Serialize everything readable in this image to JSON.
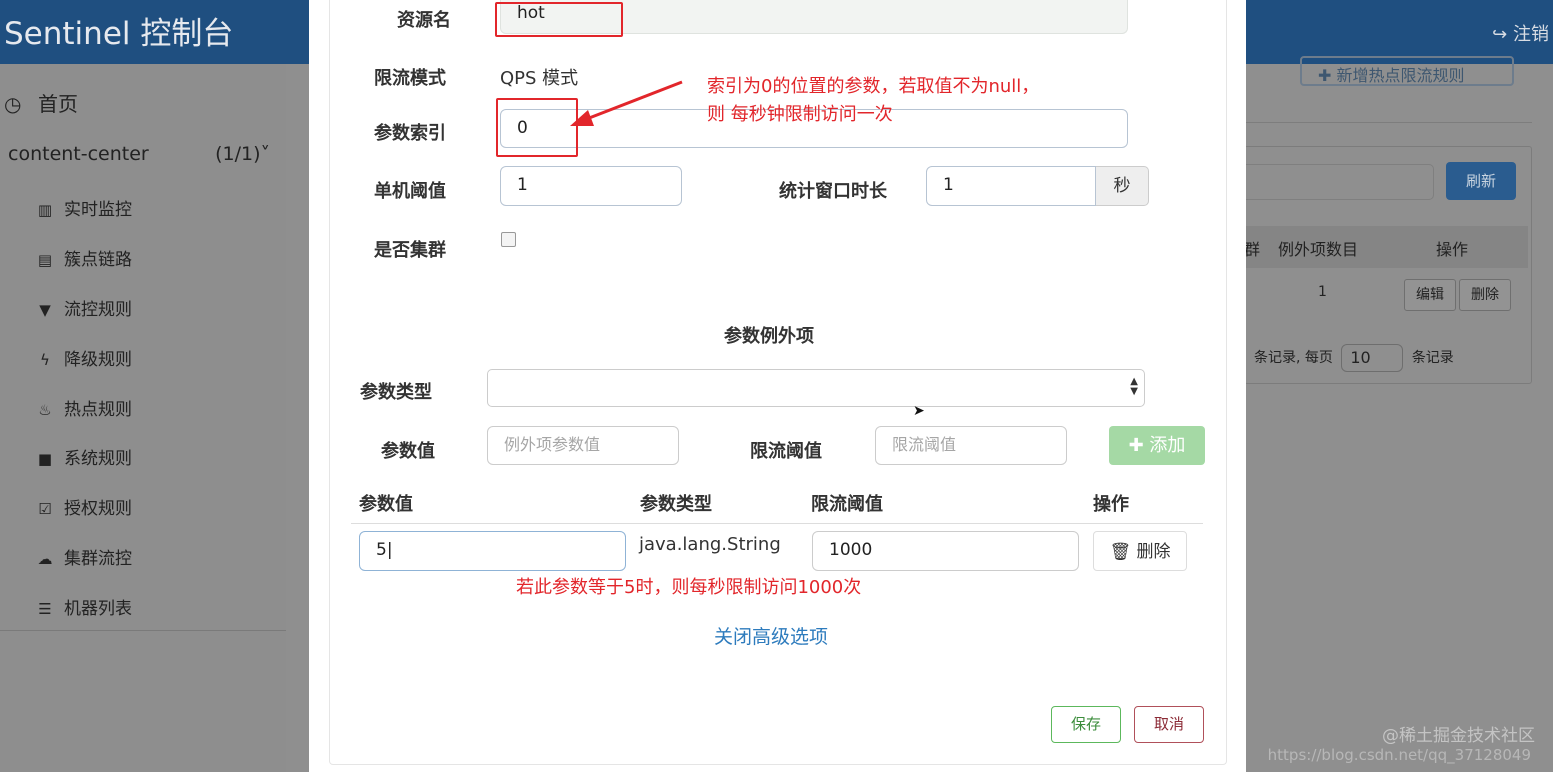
{
  "app": {
    "title": "Sentinel 控制台",
    "logout": "注销"
  },
  "sidebar": {
    "home": "首页",
    "app_name": "content-center",
    "app_count": "(1/1)",
    "items": [
      {
        "label": "实时监控",
        "icon": "bar-chart-icon"
      },
      {
        "label": "簇点链路",
        "icon": "list-icon"
      },
      {
        "label": "流控规则",
        "icon": "filter-icon"
      },
      {
        "label": "降级规则",
        "icon": "bolt-icon"
      },
      {
        "label": "热点规则",
        "icon": "fire-icon"
      },
      {
        "label": "系统规则",
        "icon": "lock-icon"
      },
      {
        "label": "授权规则",
        "icon": "check-square-icon"
      },
      {
        "label": "集群流控",
        "icon": "cloud-icon"
      },
      {
        "label": "机器列表",
        "icon": "list-ul-icon"
      }
    ]
  },
  "background": {
    "add_rule_button": "新增热点限流规则",
    "refresh_button": "刷新",
    "table_headers": [
      "群",
      "例外项数目",
      "操作"
    ],
    "row_exception_count": "1",
    "edit_button": "编辑",
    "delete_button": "删除",
    "pager_prefix": "条记录, 每页",
    "page_size": "10",
    "pager_suffix": "条记录"
  },
  "form": {
    "resource_label": "资源名",
    "resource_value": "hot",
    "mode_label": "限流模式",
    "mode_value": "QPS 模式",
    "param_index_label": "参数索引",
    "param_index_value": "0",
    "threshold_label": "单机阈值",
    "threshold_value": "1",
    "window_label": "统计窗口时长",
    "window_value": "1",
    "window_unit": "秒",
    "cluster_label": "是否集群",
    "cluster_checked": false
  },
  "exceptions": {
    "section_title": "参数例外项",
    "param_type_label": "参数类型",
    "param_type_value": "",
    "param_value_label": "参数值",
    "param_value_placeholder": "例外项参数值",
    "limit_label": "限流阈值",
    "limit_placeholder": "限流阈值",
    "add_button": "添加",
    "table_headers": [
      "参数值",
      "参数类型",
      "限流阈值",
      "操作"
    ],
    "rows": [
      {
        "value": "5",
        "type": "java.lang.String",
        "limit": "1000",
        "action": "删除"
      }
    ],
    "close_advanced": "关闭高级选项"
  },
  "footer": {
    "save": "保存",
    "cancel": "取消"
  },
  "annotations": {
    "index_note_line1": "索引为0的位置的参数，若取值不为null，",
    "index_note_line2": "则 每秒钟限制访问一次",
    "exception_note": "若此参数等于5时，则每秒限制访问1000次"
  },
  "watermark": {
    "site": "@稀土掘金技术社区",
    "url": "https://blog.csdn.net/qq_37128049"
  },
  "colors": {
    "header": "#1f4f80",
    "annotation": "#e2262b",
    "link": "#2d7bbd",
    "add_button": "#a5d9a5"
  }
}
